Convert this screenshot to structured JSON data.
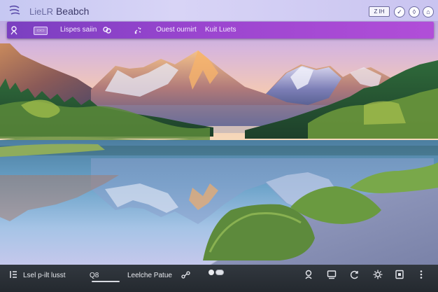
{
  "topbar": {
    "brand_prefix": "LieLR",
    "brand_name": "Beabch",
    "box_label": "Z  IH",
    "icon_names": [
      "logo-icon",
      "check-icon",
      "drop-icon",
      "home-icon"
    ],
    "check_glyph": "✓",
    "drop_glyph": "◊",
    "home_glyph": "⌂"
  },
  "navbar": {
    "items": [
      {
        "label": "Lispes saiin"
      },
      {
        "label": "Ouest ournirt"
      },
      {
        "label": "Kuit Luets"
      }
    ],
    "chip_label": "▭▭",
    "icon_names": [
      "person-pin-icon",
      "link-icon",
      "sparkle-icon"
    ]
  },
  "bottombar": {
    "left_label": "Lsel p-ilt lusst",
    "search_label": "Q8",
    "center_label": "Leelche Patue",
    "icon_names": [
      "menu-icon",
      "search-icon",
      "share-icon",
      "toggle-icon",
      "user-icon",
      "display-icon",
      "refresh-icon",
      "settings-icon",
      "panel-icon",
      "more-icon"
    ]
  },
  "colors": {
    "navbar_accent": "#9a45cf",
    "topbar_bg": "#d8d4f6",
    "bottombar_bg": "#2b3036"
  }
}
